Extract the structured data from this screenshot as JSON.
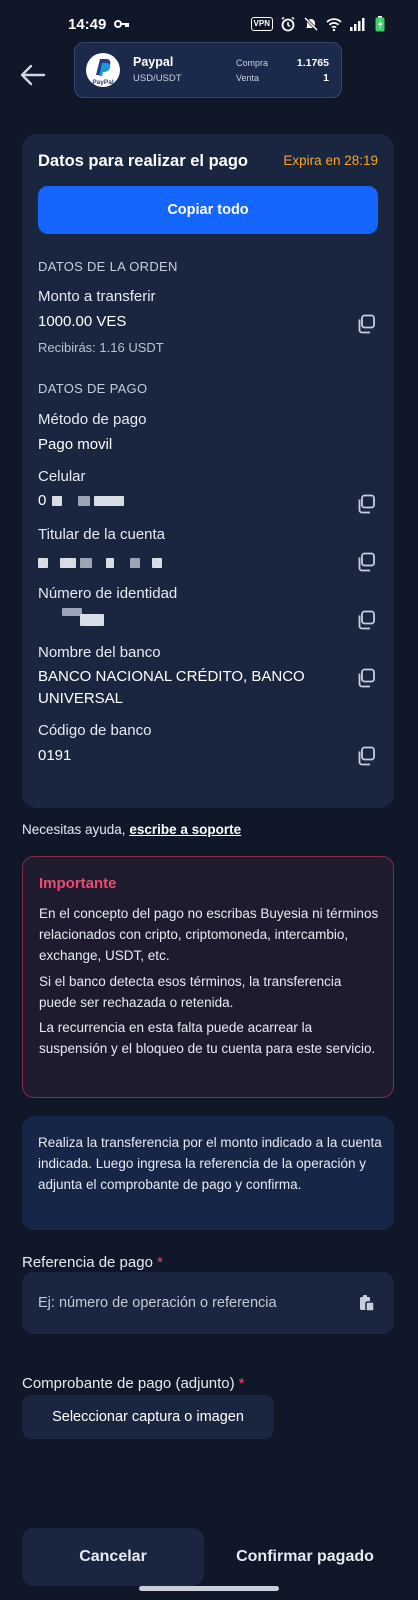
{
  "status_bar": {
    "time": "14:49",
    "vpn": "VPN"
  },
  "header": {
    "pair_name": "Paypal",
    "pair_sub": "USD/USDT",
    "buy_label": "Compra",
    "buy_value": "1.1765",
    "sell_label": "Venta",
    "sell_value": "1",
    "logo_text": "PayPal"
  },
  "card": {
    "title": "Datos para realizar el pago",
    "expires": "Expira en 28:19",
    "copy_all_label": "Copiar todo",
    "order_section": "DATOS DE LA ORDEN",
    "amount_label": "Monto a transferir",
    "amount_value": "1000.00 VES",
    "receive_text": "Recibirás: 1.16 USDT",
    "payment_section": "DATOS DE PAGO",
    "method_label": "Método de pago",
    "method_value": "Pago movil",
    "phone_label": "Celular",
    "phone_value_prefix": "0",
    "holder_label": "Titular de la cuenta",
    "id_label": "Número de identidad",
    "bank_label": "Nombre del banco",
    "bank_value": "BANCO NACIONAL CRÉDITO, BANCO UNIVERSAL",
    "bank_code_label": "Código de banco",
    "bank_code_value": "0191"
  },
  "help": {
    "text": "Necesitas ayuda,",
    "link": "escribe a soporte"
  },
  "important": {
    "title": "Importante",
    "p1": "En el concepto del pago no escribas Buyesia ni términos relacionados con cripto, criptomoneda, intercambio, exchange, USDT, etc.",
    "p2": "Si el banco detecta esos términos, la transferencia puede ser rechazada o retenida.",
    "p3": "La recurrencia en esta falta puede acarrear la suspensión y el bloqueo de tu cuenta para este servicio."
  },
  "info": {
    "text": "Realiza la transferencia por el monto indicado a la cuenta indicada. Luego ingresa la referencia de la operación y adjunta el comprobante de pago y confirma."
  },
  "form": {
    "ref_label": "Referencia de pago",
    "ref_placeholder": "Ej: número de operación o referencia",
    "receipt_label": "Comprobante de pago (adjunto)",
    "receipt_button": "Seleccionar captura o imagen",
    "required_mark": "*"
  },
  "actions": {
    "cancel": "Cancelar",
    "confirm": "Confirmar pagado"
  },
  "colors": {
    "background": "#0f1728",
    "card": "#1a2640",
    "primary": "#1466ff",
    "warning": "#f5a623",
    "danger": "#f04a6e"
  }
}
